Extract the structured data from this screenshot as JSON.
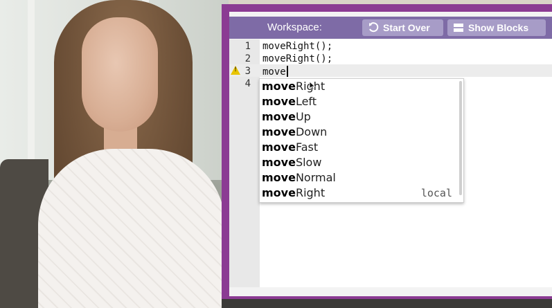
{
  "header": {
    "title": "Workspace:",
    "start_over_label": "Start Over",
    "show_blocks_label": "Show Blocks"
  },
  "editor": {
    "lines": [
      {
        "num": "1",
        "code": "moveRight();"
      },
      {
        "num": "2",
        "code": "moveRight();"
      },
      {
        "num": "3",
        "code": "move"
      },
      {
        "num": "4",
        "code": ""
      }
    ]
  },
  "autocomplete": {
    "prefix": "move",
    "items": [
      {
        "suffix": "Right",
        "meta": ""
      },
      {
        "suffix": "Left",
        "meta": ""
      },
      {
        "suffix": "Up",
        "meta": ""
      },
      {
        "suffix": "Down",
        "meta": ""
      },
      {
        "suffix": "Fast",
        "meta": ""
      },
      {
        "suffix": "Slow",
        "meta": ""
      },
      {
        "suffix": "Normal",
        "meta": ""
      },
      {
        "suffix": "Right",
        "meta": "local"
      }
    ]
  },
  "colors": {
    "panel_border": "#8b3b93",
    "header": "#7e6ba6",
    "button": "#a79cc7",
    "warning": "#e8c400"
  },
  "icons": {
    "start_over": "undo-icon",
    "show_blocks": "blocks-icon",
    "line_warning": "warning-icon"
  }
}
